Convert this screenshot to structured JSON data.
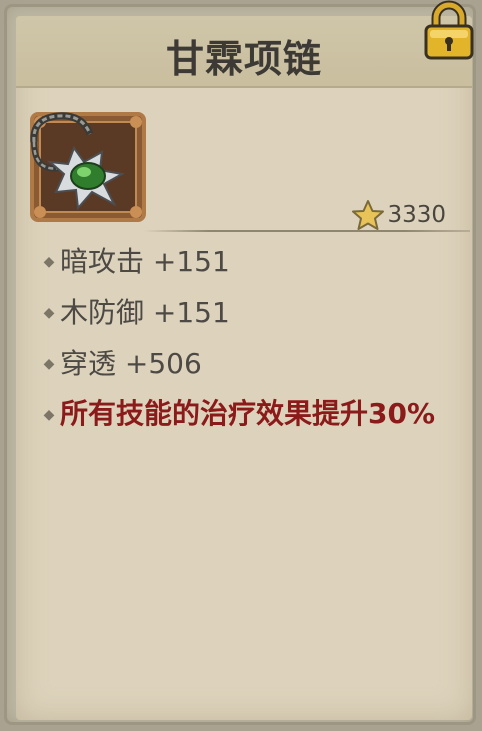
{
  "item": {
    "name": "甘霖项链",
    "score": "3330"
  },
  "stats": [
    {
      "text": "暗攻击 +151"
    },
    {
      "text": "木防御 +151"
    },
    {
      "text": "穿透 +506"
    }
  ],
  "special_effect": "所有技能的治疗效果提升30%",
  "icons": {
    "lock": "lock-icon",
    "item": "necklace-icon",
    "score": "star-icon"
  },
  "colors": {
    "special_text": "#8b1a1a",
    "lock": "#e2b42a",
    "gem": "#3f9a3b",
    "star": "#e7c35a"
  }
}
